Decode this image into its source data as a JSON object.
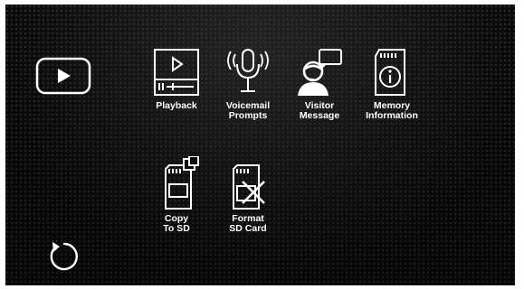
{
  "side": {
    "play_icon": "play-icon",
    "back_icon": "back-refresh-icon"
  },
  "menu": {
    "row1": [
      {
        "id": "playback",
        "label": "Playback",
        "icon": "playback-icon"
      },
      {
        "id": "voicemail-prompts",
        "label": "Voicemail\nPrompts",
        "icon": "microphone-icon"
      },
      {
        "id": "visitor-message",
        "label": "Visitor\nMessage",
        "icon": "visitor-speech-icon"
      },
      {
        "id": "memory-information",
        "label": "Memory\nInformation",
        "icon": "sd-card-info-icon"
      }
    ],
    "row2": [
      {
        "id": "copy-to-sd",
        "label": "Copy\nTo SD",
        "icon": "sd-card-copy-icon"
      },
      {
        "id": "format-sd-card",
        "label": "Format\nSD Card",
        "icon": "sd-card-format-icon"
      }
    ]
  },
  "colors": {
    "background": "#0a0a0a",
    "icon_stroke": "#ffffff",
    "text": "#ffffff"
  }
}
